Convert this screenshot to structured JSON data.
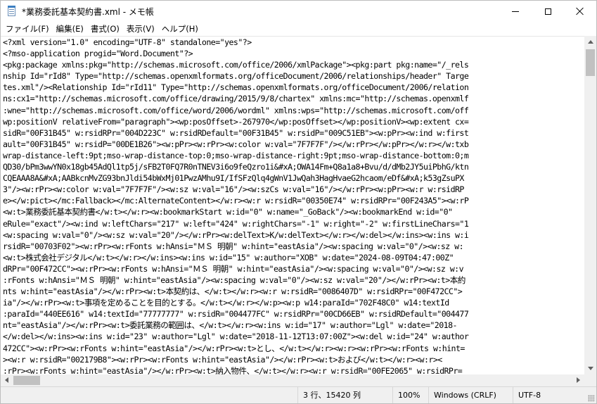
{
  "window": {
    "title": "*業務委託基本契約書.xml - メモ帳"
  },
  "menu": {
    "items": [
      "ファイル(F)",
      "編集(E)",
      "書式(O)",
      "表示(V)",
      "ヘルプ(H)"
    ]
  },
  "editor": {
    "lines": [
      "<?xml version=\"1.0\" encoding=\"UTF-8\" standalone=\"yes\"?>",
      "<?mso-application progid=\"Word.Document\"?>",
      "<pkg:package xmlns:pkg=\"http://schemas.microsoft.com/office/2006/xmlPackage\"><pkg:part pkg:name=\"/_rels",
      "nship Id=\"rId8\" Type=\"http://schemas.openxmlformats.org/officeDocument/2006/relationships/header\" Targe",
      "tes.xml\"/><Relationship Id=\"rId11\" Type=\"http://schemas.openxmlformats.org/officeDocument/2006/relation",
      "ns:cx1=\"http://schemas.microsoft.com/office/drawing/2015/9/8/chartex\" xmlns:mc=\"http://schemas.openxmlf",
      ":wne=\"http://schemas.microsoft.com/office/word/2006/wordml\" xmlns:wps=\"http://schemas.microsoft.com/off",
      "wp:positionV relativeFrom=\"paragraph\"><wp:posOffset>-267970</wp:posOffset></wp:positionV><wp:extent cx=",
      "sidR=\"00F31B45\" w:rsidRPr=\"004D223C\" w:rsidRDefault=\"00F31B45\" w:rsidP=\"009C51EB\"><w:pPr><w:ind w:first",
      "ault=\"00F31B45\" w:rsidP=\"00DE1B26\"><w:pPr><w:rPr><w:color w:val=\"7F7F7F\"/></w:rPr></w:pPr></w:r></w:txb",
      "wrap-distance-left:9pt;mso-wrap-distance-top:0;mso-wrap-distance-right:9pt;mso-wrap-distance-bottom:0;m",
      "QD30/bPm3wwYN0x18gb45AdQl1tp5j/sFB2T0FQ7R0nTNEV3i6o9feQzro1i&#xA;OWA14Fm+Q8a1a8+Bvu/d/dMb2JY5uiPbhG/ktn",
      "CQEAAA8A&#xA;AABkcnMvZG93bnJldi54bWxMj01PwzAMhu9I/IfSFzQlq4gWnV1JwQah3HagHvaeG2hcaom/eDf&#xA;k53gZsuPX",
      "3\"/><w:rPr><w:color w:val=\"7F7F7F\"/><w:sz w:val=\"16\"/><w:szCs w:val=\"16\"/></w:rPr><w:pPr><w:r w:rsidRP",
      "e></w:pict></mc:Fallback></mc:AlternateContent></w:r><w:r w:rsidR=\"00350E74\" w:rsidRPr=\"00F243A5\"><w:rP",
      "<w:t>業務委託基本契約書</w:t></w:r><w:bookmarkStart w:id=\"0\" w:name=\"_GoBack\"/><w:bookmarkEnd w:id=\"0\"",
      "eRule=\"exact\"/><w:ind w:leftChars=\"217\" w:left=\"424\" w:rightChars=\"-1\" w:right=\"-2\" w:firstLineChars=\"1",
      "<w:spacing w:val=\"0\"/><w:sz w:val=\"20\"/></w:rPr><w:delText>K/w:delText></w:r></w:del></w:ins><w:ins w:i",
      "rsidR=\"00703F02\"><w:rPr><w:rFonts w:hAnsi=\"ＭＳ 明朝\" w:hint=\"eastAsia\"/><w:spacing w:val=\"0\"/><w:sz w:",
      "<w:t>株式会社デジタル</w:t></w:r></w:ins><w:ins w:id=\"15\" w:author=\"XOB\" w:date=\"2024-08-09T04:47:00Z\"",
      "dRPr=\"00F472CC\"><w:rPr><w:rFonts w:hAnsi=\"ＭＳ 明朝\" w:hint=\"eastAsia\"/><w:spacing w:val=\"0\"/><w:sz w:v",
      ":rFonts w:hAnsi=\"ＭＳ 明朝\" w:hint=\"eastAsia\"/><w:spacing w:val=\"0\"/><w:sz w:val=\"20\"/></w:rPr><w:t>本約",
      "nts w:hint=\"eastAsia\"/></w:rPr><w:t>本契約は、</w:t></w:r><w:r w:rsidR=\"0086407D\" w:rsidRPr=\"00F472CC\">",
      "ia\"/></w:rPr><w:t>事項を定めることを目的とする。</w:t></w:r></w:p><w:p w14:paraId=\"702F48C0\" w14:textId",
      ":paraId=\"440EE616\" w14:textId=\"77777777\" w:rsidR=\"004477FC\" w:rsidRPr=\"00CD66EB\" w:rsidRDefault=\"004477",
      "nt=\"eastAsia\"/></w:rPr><w:t>委託業務の範囲は、</w:t></w:r><w:ins w:id=\"17\" w:author=\"Lgl\" w:date=\"2018-",
      "</w:del></w:ins><w:ins w:id=\"23\" w:author=\"Lgl\" w:date=\"2018-11-12T13:07:00Z\"><w:del w:id=\"24\" w:author",
      "472CC\"><w:rPr><w:rFonts w:hint=\"eastAsia\"/></w:rPr><w:t>とし、</w:t></w:r><w:r><w:rPr><w:rFonts w:hint=",
      "><w:r w:rsidR=\"002179B8\"><w:rPr><w:rFonts w:hint=\"eastAsia\"/></w:rPr><w:t>および</w:t></w:r><w:r><",
      ":rPr><w:rFonts w:hint=\"eastAsia\"/></w:rPr><w:t>納入物件、</w:t></w:r><w:r w:rsidR=\"00FE2065\" w:rsidRPr="
    ]
  },
  "statusbar": {
    "position": "3 行、15420 列",
    "zoom": "100%",
    "line_ending": "Windows (CRLF)",
    "encoding": "UTF-8"
  },
  "icons": {
    "app": "notepad-icon",
    "minimize": "minimize-icon",
    "maximize": "maximize-icon",
    "close": "close-icon"
  }
}
